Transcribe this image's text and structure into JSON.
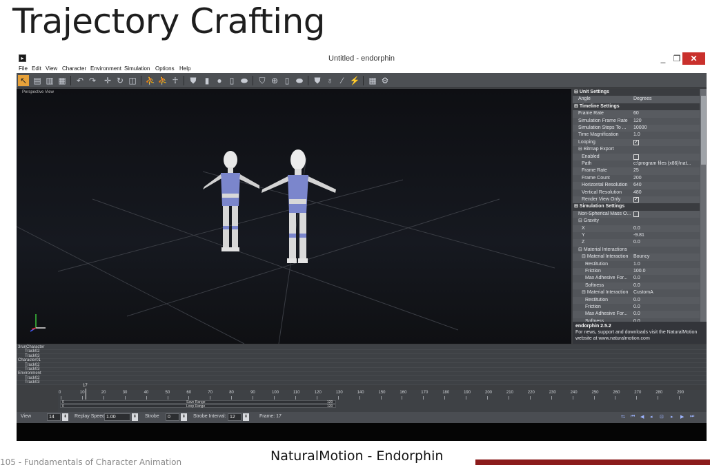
{
  "slide": {
    "title": "Trajectory Crafting",
    "caption": "NaturalMotion - Endorphin",
    "footer": "105 - Fundamentals of Character Animation",
    "accent_color": "#8b1c1c"
  },
  "window": {
    "title": "Untitled - endorphin",
    "minimize_label": "_",
    "maximize_label": "❐",
    "close_label": "✕"
  },
  "menu": [
    "File",
    "Edit",
    "View",
    "Character",
    "Environment",
    "Simulation",
    "Options",
    "Help"
  ],
  "viewport": {
    "label": "Perspective View"
  },
  "properties": {
    "rows": [
      {
        "type": "section",
        "label": "Unit Settings",
        "value": ""
      },
      {
        "type": "row",
        "indent": 1,
        "label": "Angle",
        "value": "Degrees"
      },
      {
        "type": "section",
        "label": "Timeline Settings",
        "value": ""
      },
      {
        "type": "row",
        "indent": 1,
        "label": "Frame Rate",
        "value": "60"
      },
      {
        "type": "row",
        "indent": 1,
        "label": "Simulation Frame Rate",
        "value": "120"
      },
      {
        "type": "row",
        "indent": 1,
        "label": "Simulation Steps To ...",
        "value": "10000"
      },
      {
        "type": "row",
        "indent": 1,
        "label": "Time Magnification",
        "value": "1.0"
      },
      {
        "type": "row",
        "indent": 1,
        "label": "Looping",
        "value": "",
        "check": true
      },
      {
        "type": "group",
        "indent": 1,
        "label": "Bitmap Export",
        "value": ""
      },
      {
        "type": "row",
        "indent": 2,
        "label": "Enabled",
        "value": "",
        "check": false
      },
      {
        "type": "row",
        "indent": 2,
        "label": "Path",
        "value": "c:\\program files (x86)\\nat..."
      },
      {
        "type": "row",
        "indent": 2,
        "label": "Frame Rate",
        "value": "25"
      },
      {
        "type": "row",
        "indent": 2,
        "label": "Frame Count",
        "value": "200"
      },
      {
        "type": "row",
        "indent": 2,
        "label": "Horizontal Resolution",
        "value": "640"
      },
      {
        "type": "row",
        "indent": 2,
        "label": "Vertical Resolution",
        "value": "480"
      },
      {
        "type": "row",
        "indent": 2,
        "label": "Render View Only",
        "value": "",
        "check": true
      },
      {
        "type": "section",
        "label": "Simulation Settings",
        "value": ""
      },
      {
        "type": "row",
        "indent": 1,
        "label": "Non-Spherical Mass O...",
        "value": "",
        "check": false
      },
      {
        "type": "group",
        "indent": 1,
        "label": "Gravity",
        "value": ""
      },
      {
        "type": "row",
        "indent": 2,
        "label": "X",
        "value": "0.0"
      },
      {
        "type": "row",
        "indent": 2,
        "label": "Y",
        "value": "-9.81"
      },
      {
        "type": "row",
        "indent": 2,
        "label": "Z",
        "value": "0.0"
      },
      {
        "type": "group",
        "indent": 1,
        "label": "Material Interactions",
        "value": ""
      },
      {
        "type": "group",
        "indent": 2,
        "label": "Material Interaction",
        "value": "Bouncy"
      },
      {
        "type": "row",
        "indent": 3,
        "label": "Restitution",
        "value": "1.0"
      },
      {
        "type": "row",
        "indent": 3,
        "label": "Friction",
        "value": "100.0"
      },
      {
        "type": "row",
        "indent": 3,
        "label": "Max Adhesive For...",
        "value": "0.0"
      },
      {
        "type": "row",
        "indent": 3,
        "label": "Softness",
        "value": "0.0"
      },
      {
        "type": "group",
        "indent": 2,
        "label": "Material Interaction",
        "value": "CustomA"
      },
      {
        "type": "row",
        "indent": 3,
        "label": "Restitution",
        "value": "0.0"
      },
      {
        "type": "row",
        "indent": 3,
        "label": "Friction",
        "value": "0.0"
      },
      {
        "type": "row",
        "indent": 3,
        "label": "Max Adhesive For...",
        "value": "0.0"
      },
      {
        "type": "row",
        "indent": 3,
        "label": "Softness",
        "value": "0.0"
      }
    ],
    "info_title": "endorphin 2.5.2",
    "info_text": "For news, support and downloads visit the NaturalMotion website at www.naturalmotion.com"
  },
  "tracks": [
    {
      "label": "3runCharacter",
      "group": true
    },
    {
      "label": "Track02",
      "group": false
    },
    {
      "label": "Track03",
      "group": false
    },
    {
      "label": "Character01",
      "group": true
    },
    {
      "label": "Track02",
      "group": false
    },
    {
      "label": "Track03",
      "group": false
    },
    {
      "label": "Environment",
      "group": true
    },
    {
      "label": "Track02",
      "group": false
    },
    {
      "label": "Track03",
      "group": false
    }
  ],
  "timeline": {
    "ticks": [
      "0",
      "10",
      "20",
      "30",
      "40",
      "50",
      "60",
      "70",
      "80",
      "90",
      "100",
      "110",
      "120",
      "130",
      "140",
      "150",
      "160",
      "170",
      "180",
      "190",
      "200",
      "210",
      "220",
      "230",
      "240",
      "250",
      "260",
      "270",
      "280",
      "290"
    ],
    "save_range": {
      "label": "Save Range",
      "start": "0",
      "end": "120"
    },
    "loop_range": {
      "label": "Loop Range",
      "start": "0",
      "end": "120"
    },
    "playhead": "17"
  },
  "statusbar": {
    "view_label": "View",
    "view_value": "14",
    "replay_label": "Replay Speed:",
    "replay_value": "1.00",
    "strobe_label": "Strobe",
    "strobe_value": "0",
    "strobe_interval_label": "Strobe Interval:",
    "strobe_interval_value": "12",
    "frame_text": "Frame: 17"
  }
}
